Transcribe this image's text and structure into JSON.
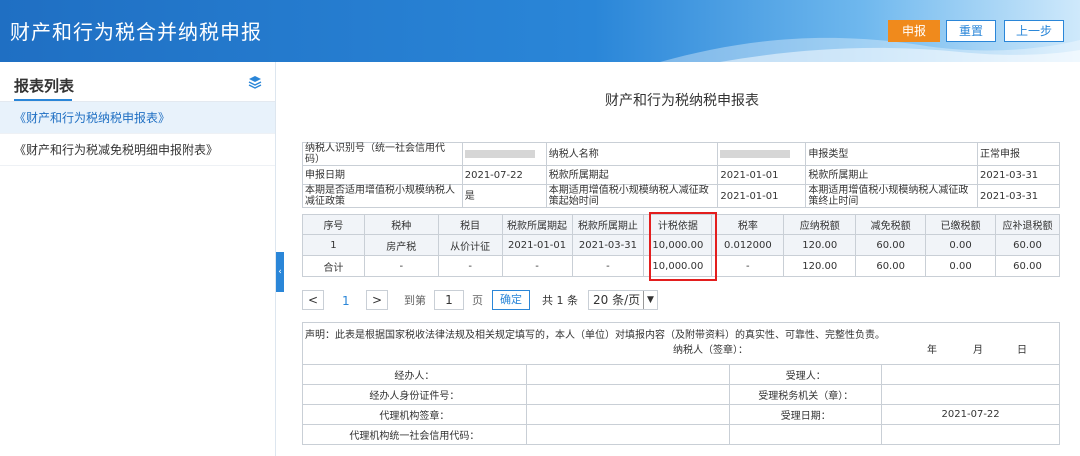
{
  "header": {
    "title": "财产和行为税合并纳税申报",
    "btn_submit": "申报",
    "btn_reset": "重置",
    "btn_prev": "上一步",
    "colors": {
      "primary": "#2a86d8",
      "accent": "#f08a1c"
    }
  },
  "sidebar": {
    "title": "报表列表",
    "icon": "layers-icon",
    "items": [
      {
        "label": "《财产和行为税纳税申报表》"
      },
      {
        "label": "《财产和行为税减免税明细申报附表》"
      }
    ]
  },
  "form": {
    "title": "财产和行为税纳税申报表",
    "info": {
      "taxpayer_id_label": "纳税人识别号（统一社会信用代码）",
      "taxpayer_name_label": "纳税人名称",
      "declare_type_label": "申报类型",
      "declare_type_value": "正常申报",
      "declare_date_label": "申报日期",
      "declare_date_value": "2021-07-22",
      "period_start_label": "税款所属期起",
      "period_start_value": "2021-01-01",
      "period_end_label": "税款所属期止",
      "period_end_value": "2021-03-31",
      "small_scale_label": "本期是否适用增值税小规模纳税人减征政策",
      "small_scale_value": "是",
      "policy_start_label": "本期适用增值税小规模纳税人减征政策起始时间",
      "policy_start_value": "2021-01-01",
      "policy_end_label": "本期适用增值税小规模纳税人减征政策终止时间",
      "policy_end_value": "2021-03-31"
    },
    "columns": [
      "序号",
      "税种",
      "税目",
      "税款所属期起",
      "税款所属期止",
      "计税依据",
      "税率",
      "应纳税额",
      "减免税额",
      "已缴税额",
      "应补退税额"
    ],
    "rows": [
      [
        "1",
        "房产税",
        "从价计征",
        "2021-01-01",
        "2021-03-31",
        "10,000.00",
        "0.012000",
        "120.00",
        "60.00",
        "0.00",
        "60.00"
      ],
      [
        "合计",
        "-",
        "-",
        "-",
        "-",
        "10,000.00",
        "-",
        "120.00",
        "60.00",
        "0.00",
        "60.00"
      ]
    ]
  },
  "pager": {
    "prev": "<",
    "page": "1",
    "next": ">",
    "goto_label": "到第",
    "goto_value": "1",
    "page_unit": "页",
    "confirm": "确定",
    "total": "共 1 条",
    "page_size": "20 条/页"
  },
  "declaration": {
    "statement": "声明：此表是根据国家税收法律法规及相关规定填写的，本人（单位）对填报内容（及附带资料）的真实性、可靠性、完整性负责。",
    "signer": "纳税人（签章）：",
    "year": "年",
    "month": "月",
    "day": "日",
    "agent": "经办人：",
    "agent_id": "经办人身份证件号：",
    "agency_seal": "代理机构签章：",
    "agency_code": "代理机构统一社会信用代码：",
    "receiver": "受理人：",
    "tax_office": "受理税务机关（章）：",
    "receive_date_label": "受理日期：",
    "receive_date_value": "2021-07-22"
  }
}
